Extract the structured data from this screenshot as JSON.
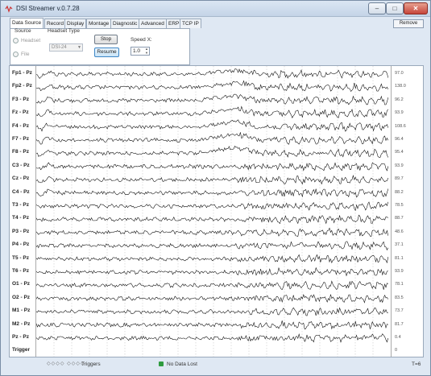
{
  "window": {
    "title": "DSI Streamer v.0.7.28",
    "min_symbol": "–",
    "max_symbol": "□",
    "close_symbol": "✕"
  },
  "tabs": [
    {
      "label": "Data Source",
      "active": true
    },
    {
      "label": "Record"
    },
    {
      "label": "Display"
    },
    {
      "label": "Montage"
    },
    {
      "label": "Diagnostic"
    },
    {
      "label": "Advanced"
    },
    {
      "label": "ERP"
    },
    {
      "label": "TCP IP"
    }
  ],
  "remove_button": "Remove",
  "source_panel": {
    "source_label": "Source",
    "headset_type_label": "Headset Type",
    "radio_headset": "Headset",
    "radio_file": "File",
    "headset_value": "DSI-24",
    "stop_button": "Stop",
    "resume_button": "Resume",
    "speed_label": "Speed X:",
    "speed_value": "1.0"
  },
  "channels": [
    {
      "label": "Fp1 - Pz",
      "value": "97.0"
    },
    {
      "label": "Fp2 - Pz",
      "value": "138.0"
    },
    {
      "label": "F3 - Pz",
      "value": "96.2"
    },
    {
      "label": "Fz - Pz",
      "value": "93.9"
    },
    {
      "label": "F4 - Pz",
      "value": "108.6"
    },
    {
      "label": "F7 - Pz",
      "value": "96.4"
    },
    {
      "label": "F8 - Pz",
      "value": "95.4"
    },
    {
      "label": "C3 - Pz",
      "value": "93.9"
    },
    {
      "label": "Cz - Pz",
      "value": "89.7"
    },
    {
      "label": "C4 - Pz",
      "value": "88.2"
    },
    {
      "label": "T3 - Pz",
      "value": "78.5"
    },
    {
      "label": "T4 - Pz",
      "value": "88.7"
    },
    {
      "label": "P3 - Pz",
      "value": "48.6"
    },
    {
      "label": "P4 - Pz",
      "value": "37.1"
    },
    {
      "label": "T5 - Pz",
      "value": "81.1"
    },
    {
      "label": "T6 - Pz",
      "value": "93.9"
    },
    {
      "label": "O1 - Pz",
      "value": "78.1"
    },
    {
      "label": "O2 - Pz",
      "value": "83.5"
    },
    {
      "label": "M1 - Pz",
      "value": "73.7"
    },
    {
      "label": "M2 - Pz",
      "value": "81.7"
    },
    {
      "label": "Pz - Pz",
      "value": "0.4"
    },
    {
      "label": "Trigger",
      "value": "0"
    }
  ],
  "statusbar": {
    "trigger_boxes": "◇◇◇◇ ◇◇◇◇",
    "triggers_label": "Triggers",
    "no_data_lost": "No Data Lost",
    "time_value": "T=6"
  },
  "colors": {
    "trace": "#000000",
    "resume_accent": "#3d86c6",
    "status_ok": "#2e9b3f"
  }
}
